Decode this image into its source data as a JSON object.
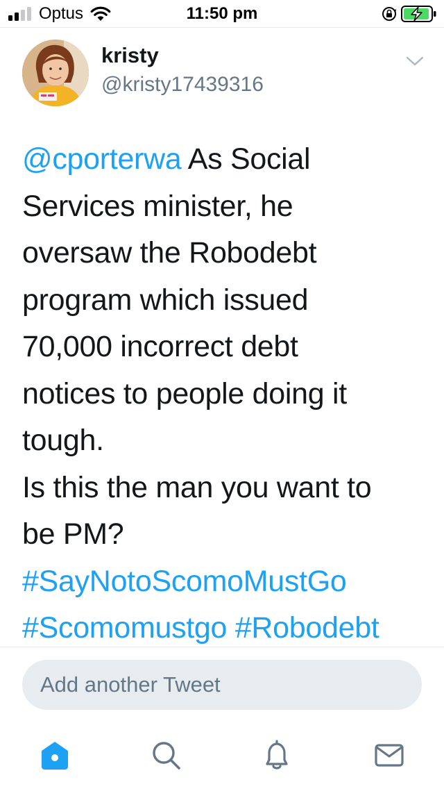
{
  "status_bar": {
    "carrier": "Optus",
    "time": "11:50 pm",
    "icons": [
      "signal-icon",
      "wifi-icon",
      "orientation-lock-icon",
      "battery-charging-icon"
    ]
  },
  "tweet": {
    "author": {
      "display_name": "kristy",
      "handle": "@kristy17439316"
    },
    "body": {
      "line_1_mention": "@cporterwa",
      "line_1_text": " As Social",
      "line_2": "Services minister, he",
      "line_3": "oversaw the Robodebt",
      "line_4": "program which issued",
      "line_5": "70,000 incorrect debt",
      "line_6": "notices to people doing it",
      "line_7": "tough.",
      "line_8": "Is this the man you want to",
      "line_9": "be PM?",
      "hashtag_1": "#SayNotoScomoMustGo",
      "hashtag_2": "#Scomomustgo",
      "hashtag_3": "#Robodebt"
    }
  },
  "reply": {
    "placeholder": "Add another Tweet"
  },
  "tab_bar": {
    "tabs": [
      "home-icon",
      "search-icon",
      "notifications-icon",
      "messages-icon"
    ],
    "active": "home-icon"
  },
  "colors": {
    "accent": "#1da1f2",
    "text": "#14171a",
    "secondary": "#657786",
    "input_bg": "#e6ecf0"
  }
}
